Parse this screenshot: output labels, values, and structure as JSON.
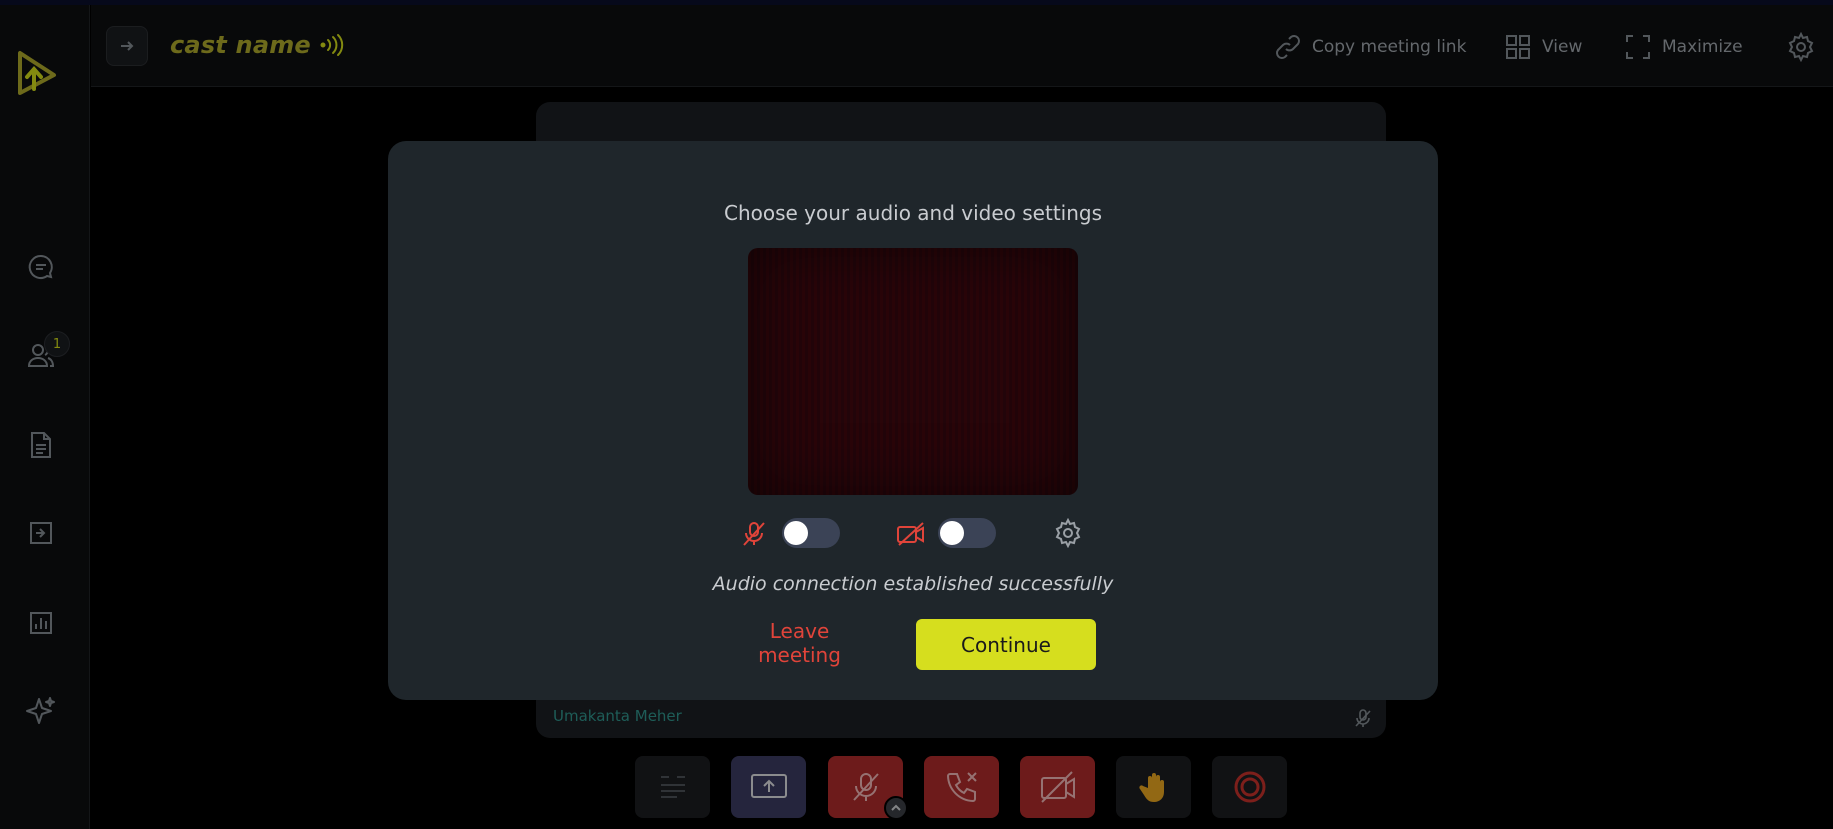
{
  "header": {
    "title": "cast name",
    "copy_link_label": "Copy meeting link",
    "view_label": "View",
    "maximize_label": "Maximize"
  },
  "sidebar": {
    "participants_badge": "1"
  },
  "tile": {
    "participant_name": "Umakanta Meher"
  },
  "modal": {
    "title": "Choose your audio and video settings",
    "status": "Audio connection established successfully",
    "leave_label": "Leave meeting",
    "continue_label": "Continue",
    "mic_enabled": false,
    "camera_enabled": false
  },
  "colors": {
    "brand": "#c9d41a",
    "danger": "#a82a2a",
    "accent_button": "#d6de1e",
    "modal_bg": "#1f262b"
  }
}
